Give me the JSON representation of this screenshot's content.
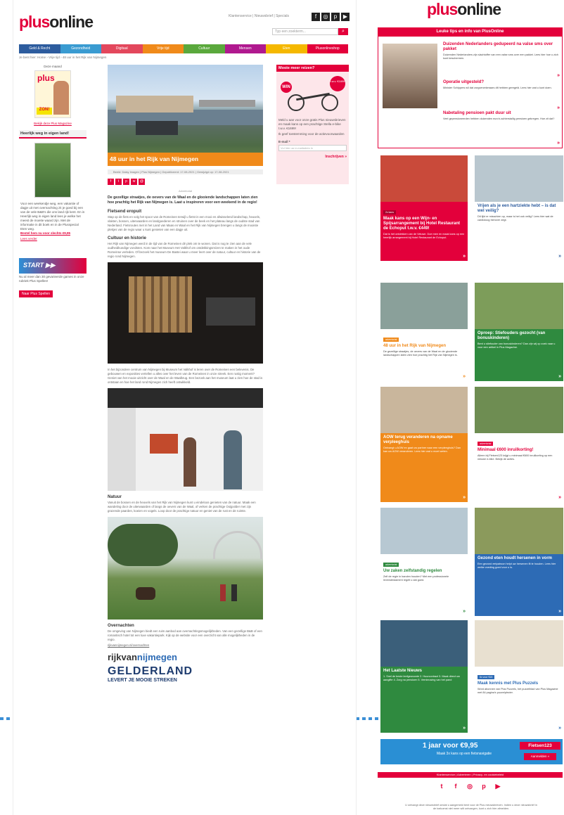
{
  "left_page": {
    "logo": {
      "plus": "plus",
      "online": "online"
    },
    "top_links": "Klantenservice | Nieuwsbrief | Specials",
    "search": {
      "placeholder": "Typ een zoekterm...",
      "button_icon": "search-icon"
    },
    "nav": [
      {
        "label": "Geld & Recht",
        "color": "#2d5c9e"
      },
      {
        "label": "Gezondheid",
        "color": "#3a9bd1"
      },
      {
        "label": "Digitaal",
        "color": "#e3475c"
      },
      {
        "label": "Vrije tijd",
        "color": "#f08a1a"
      },
      {
        "label": "Cultuur",
        "color": "#5aa83c"
      },
      {
        "label": "Mensen",
        "color": "#b0198f"
      },
      {
        "label": "Eten",
        "color": "#f5b800"
      },
      {
        "label": "Plusonlineshop",
        "color": "#e3003b"
      }
    ],
    "breadcrumb": "Je bent hier: Home › Vrije tijd › 48 uur in het Rijk van Nijmegen",
    "sidebar": {
      "mag_label": "Deze maand",
      "mag_title": "plus",
      "mag_cta": "Bekijk deze Plus Magazine",
      "box_title": "Heerlijk weg in eigen land!",
      "book_text": "Voor een weekendje weg, een vakantie of dagje uit met overnachting zit je goed bij een van de vele B&B's die ons land rijk kent. En in Heerlijk weg in eigen land lees je welke het meest de moeite waard zijn. Met de informatie in dit boek en in de Plusspecial Eten weg.",
      "book_link": "Bestel hem nu voor slechts €9,95",
      "book_more": "Lees verder",
      "start_title": "START",
      "start_text": "Nu al meer dan 30 gevarieerde games in onze rubriek Plus Spellen!",
      "start_btn": "Naar Plus Spellen"
    },
    "article": {
      "title": "48 uur in het Rijk van Nijmegen",
      "meta": "Beeld: Daisy Imagen | Plus Nijmegen | Gepubliceerd: 17-08-2021 | Gewijzigd op: 17-08-2021",
      "share": [
        "f",
        "t",
        "p",
        "w",
        "@"
      ],
      "adv": "Advertorial",
      "intro": "De gezellige straatjes, de oevers van de Waal en de glooiende landschappen laten zien hoe prachtig het Rijk van Nijmegen is. Laat u inspireren voor een weekend in de regio!",
      "s1_title": "Fietsend eropuit",
      "s1_body": "Stap op de fiets en volg het spoor van de Romeinen terwijl u fietst in een mooi en afwisselend landschap, heuvels, vlakten, bossen, uiterwaarden en landgoederen en struinen over de beek en het plateau langs de oudste stad van Nederland. Fietsroutes met in het Land van Maas en Waal en het Rijk van Nijmegen brengen u langs de mooiste plekjes van de regio waar u kunt genieten van een dagje uit.",
      "s2_title": "Cultuur en historie",
      "s2_body": "Het Rijk van Nijmegen werd in de tijd van de Romeinen dé plek om te wonen. Dat is nog te zien aan de vele oudheidkundige vondsten. Kom naar het Museum Het Valkhof om ontdekkingsreizen te maken in het oude Romeinse verleden. Of bezoek het museum De Bastei waar u meer leert over de natuur, cultuur en historie van de regio rond Nijmegen.",
      "s3_body": "In het bijzondere centrum van Nijmegen bij Museum het Valkhof is leren over de Romeinen een belevenis. De gebouwen en exposities vertellen u alles over het leven van de Romeinen in onze streek. Een rustig moment? Geniet van het mooie uitzicht over de Waal en de Waalbrug. Een bezoek aan het museum laat u zien hoe de stad is ontstaan en hoe het land rond Nijmegen zich heeft ontwikkeld.",
      "s4_title": "Natuur",
      "s4_body": "Vanuit de bossen en de heuvels van het Rijk van Nijmegen kunt u eindeloos genieten van de natuur. Maak een wandeling door de uiterwaarden of langs de oevers van de Waal, of verken de prachtige Ooijpolder met zijn grazende paarden, koeien en vogels. Loop door de prachtige natuur en geniet van de rust en de ruimte.",
      "s5_title": "Overnachten",
      "s5_body": "De omgeving van Nijmegen biedt een ruim aanbod aan overnachtingsmogelijkheden. Van een gezellige B&B of een romantisch hotel tot een luxe vakantiepark. Kijk op de website voor een overzicht van alle mogelijkheden in de regio.",
      "s5_link": "rijkvannijmegen.nl/overnachten",
      "logo1_a": "rijkvan",
      "logo1_b": "nijmegen",
      "logo2_a": "GELDERLAND",
      "logo2_b": "LEVERT JE MOOIE STREKEN"
    },
    "right_ad": {
      "title": "Mooie meer reizen?",
      "badge": "WIN",
      "price_tag": "t.w.v. €1699",
      "text": "Meld u aan voor onze gratis Plus nieuwsbrieven en maak kans op een prachtige Stella e-bike t.w.v. €1699!",
      "link_text": "Stella e-bike",
      "legal": "Ik geef toestemming voor de actievoorwaarden",
      "email_label": "E-mail *",
      "email_placeholder": "Vul hier uw e-mailadres in",
      "submit": "Inschrijven »"
    }
  },
  "right_page": {
    "logo": {
      "plus": "plus",
      "online": "online"
    },
    "header": "Leuke tips en info van PlusOnline",
    "top_items": [
      {
        "title": "Duizenden Nederlanders gedupeerd na valse sms over pakket",
        "text": "Duizenden Nederlanders zijn slachtoffer van een valse sms over een pakket. Lees hier hoe u zich kunt beschermen."
      },
      {
        "title": "Operatie uitgesteld?",
        "text": "Minister Schippers wil dat zorgverzekeraars dit hebben geregeld. Lees hier wat u kunt doen."
      },
      {
        "title": "Nabetaling pensioen pakt duur uit",
        "text": "Veel gepensioneerden hebben duizenden euro's achterstallig pensioen gekregen. Hoe zit dat?"
      }
    ],
    "cards": [
      {
        "title": "Maak kans op een Wijn- en Spijsarrangement bij Hotel Restaurant de Echoput t.w.v. €449!",
        "text": "Dat is het ontdekken van de Veluwe. Doe mee en maak kans op een heerlijk arrangement bij Hotel Restaurant de Echoput.",
        "bg": "#e3003b",
        "badge": "2x kans"
      },
      {
        "title": "Vrijen als je een hartziekte hebt – is dat wel veilig?",
        "text": "Dit lijkt er misschien op, maar is het ook veilig? Lees hier wat de cardioloog hierover zegt.",
        "bg": "#ffffff",
        "title_color": "#2d5c9e"
      },
      {
        "title": "48 uur in het Rijk van Nijmegen",
        "text": "De gezellige straatjes, de oevers van de Waal en de glooiende landschappen laten zien hoe prachtig het Rijk van Nijmegen is.",
        "bg": "#ffffff",
        "title_color": "#f08a1a",
        "badge": "advertorial"
      },
      {
        "title": "Oproep: Stiefouders gezocht (van bonuskinderen)",
        "text": "Bent u stiefouder van bonuskinderen? Dan zijn wij op zoek naar u voor een artikel in Plus Magazine.",
        "bg": "#2f8a3f"
      },
      {
        "title": "AOW terug veranderen na opname verpleeghuis",
        "text": "Ontvangt u AOW en gaat uw partner naar een verpleeghuis? Dan kan uw AOW veranderen. Lees hier wat u moet weten.",
        "bg": "#f08a1a"
      },
      {
        "title": "Minimaal €600 inruilkorting!",
        "text": "Alleen bij Fietsen123 krijgt u minimaal €600 inruilkorting op een nieuwe e-bike. Bekijk de acties.",
        "bg": "#ffffff",
        "title_color": "#e3003b",
        "badge": "advertorial"
      },
      {
        "title": "Uw zaken zelfstandig regelen",
        "text": "Zelf de regie in handen houden? Met een professionele levenstestament regelt u dat goed.",
        "bg": "#ffffff",
        "title_color": "#2f8a3f",
        "badge": "advertorial"
      },
      {
        "title": "Gezond eten houdt hersenen in vorm",
        "text": "Een gezond eetpatroon helpt uw hersenen fit te houden. Lees hier welke voeding goed voor u is.",
        "bg": "#2d6bb5"
      },
      {
        "title": "Het Laatste Nieuws",
        "text": "1. Snel de beste leefgewoonte  2. Huurcontract  3. Maak direct uw aangifte  4. Zorg na pensioen  5. Vernieuwing van het pand",
        "bg": "#2f8a3f"
      },
      {
        "title": "Maak kennis met Plus Puzzels",
        "text": "Word abonnee van Plus Puzzels, het puzzelblad van Plus Magazine met 84 pagina's puzzelplezier.",
        "bg": "#ffffff",
        "title_color": "#2d6bb5",
        "badge": "6x voor €15"
      }
    ],
    "banner": {
      "text": "1 jaar voor €9,95",
      "sub": "Maak 3x kans op een fietsnavigatie",
      "brand": "Fietsen123",
      "btn": "Aanmelden »"
    },
    "footer_links": "Klantenservice | Adverteren | Privacy- en cookiebeleid",
    "footnote": "U ontvangt deze nieuwsbrief omdat u aangemeld bent voor de Plus nieuwsbrieven. Indien u deze nieuwsbrief in de toekomst niet meer wilt ontvangen, kunt u zich hier afmelden.",
    "colors": {
      "brand": "#e3003b",
      "orange": "#f08a1a",
      "green": "#2f8a3f",
      "blue": "#2d6bb5"
    }
  }
}
